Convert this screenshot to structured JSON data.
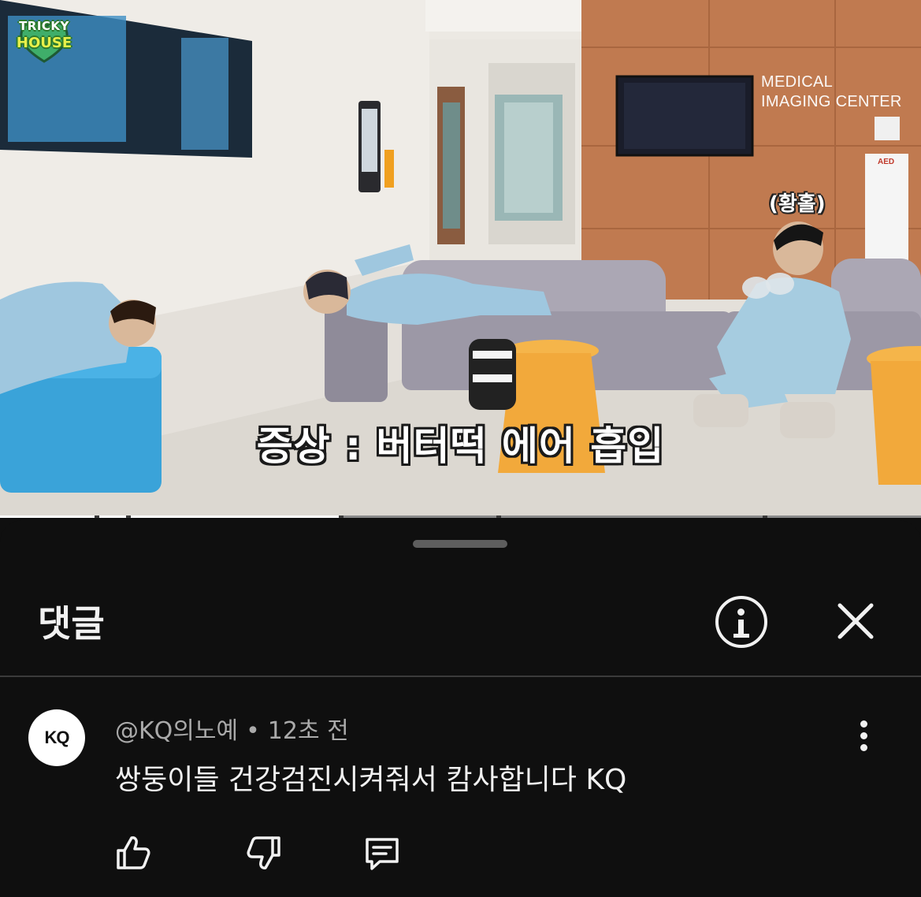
{
  "video": {
    "channel_logo": {
      "line1": "TRICKY",
      "line2": "HOUSE"
    },
    "sign_text": [
      "MEDICAL",
      "IMAGING CENTER"
    ],
    "aed_label": "AED",
    "annotation": "(황홀)",
    "subtitle": "증상 : 버터떡 에어 흡입",
    "progress_fraction": 0.37
  },
  "comments_sheet": {
    "title": "댓글",
    "info_icon": "info-icon",
    "close_icon": "close-icon",
    "comment": {
      "avatar_text": "KQ",
      "author": "@KQ의노예",
      "separator": "•",
      "time": "12초 전",
      "text": "쌍둥이들 건강검진시켜줘서 캄사합니다 KQ",
      "actions": [
        "like-icon",
        "dislike-icon",
        "reply-icon"
      ]
    }
  },
  "colors": {
    "sheet_background": "#0f0f0f",
    "text_primary": "#f1f1f1",
    "text_secondary": "#aaaaaa",
    "wall_panel": "#c07a50",
    "sofa_blue": "#3aa3d9",
    "sofa_grey": "#a9a5b2",
    "stool_orange": "#f2a93b"
  }
}
